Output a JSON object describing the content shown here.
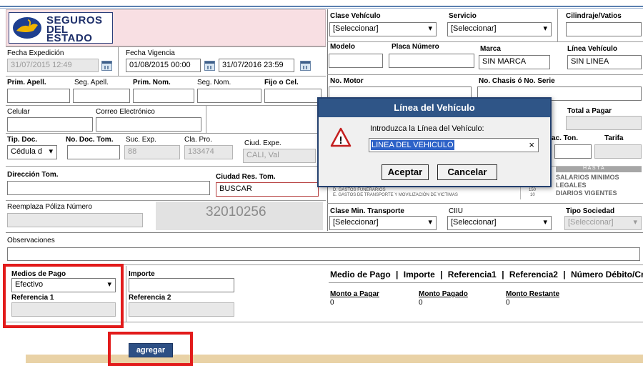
{
  "logo": {
    "line1": "SEGUROS",
    "line2": "DEL",
    "line3": "ESTADO"
  },
  "dates": {
    "fecha_expedicion_label": "Fecha Expedición",
    "fecha_expedicion": "31/07/2015 12:49",
    "fecha_vigencia_label": "Fecha Vigencia",
    "vigencia_desde": "01/08/2015 00:00",
    "vigencia_hasta": "31/07/2016 23:59"
  },
  "vehicle": {
    "clase_label": "Clase Vehículo",
    "clase_value": "[Seleccionar]",
    "servicio_label": "Servicio",
    "servicio_value": "[Seleccionar]",
    "cilindraje_label": "Cilindraje/Vatios",
    "modelo_label": "Modelo",
    "placa_label": "Placa Número",
    "marca_label": "Marca",
    "marca_value": "SIN MARCA",
    "linea_label": "Línea Vehículo",
    "linea_value": "SIN LINEA",
    "motor_label": "No. Motor",
    "chasis_label": "No. Chasis ó No. Serie",
    "total_label": "Total a Pagar",
    "cap_ton_label": "ac. Ton.",
    "tarifa_label": "Tarifa",
    "hasta_title": "H A S T A",
    "hasta_1": "SALARIOS MINIMOS",
    "hasta_2": "LEGALES",
    "hasta_3": "DIARIOS VIGENTES",
    "gastos_1": "D. GASTOS FUNERARIOS",
    "gastos_2": "E. GASTOS DE TRANSPORTE Y MOVILIZACIÓN DE VICTIMAS",
    "gastos_v1": "150",
    "gastos_v2": "10"
  },
  "tomador": {
    "prim_apell_label": "Prim. Apell.",
    "seg_apell_label": "Seg. Apell.",
    "prim_nom_label": "Prim. Nom.",
    "seg_nom_label": "Seg. Nom.",
    "fijo_label": "Fijo o Cel.",
    "celular_label": "Celular",
    "correo_label": "Correo Electrónico",
    "tip_doc_label": "Tip. Doc.",
    "tip_doc_value": "Cédula d",
    "no_doc_label": "No. Doc. Tom.",
    "suc_exp_label": "Suc. Exp.",
    "suc_exp_value": "88",
    "cla_pro_label": "Cla. Pro.",
    "cla_pro_value": "133474",
    "ciud_expe_label": "Ciud. Expe.",
    "ciud_expe_value": "CALI, Val",
    "direccion_label": "Dirección Tom.",
    "ciudad_res_label": "Ciudad Res. Tom.",
    "ciudad_res_value": "BUSCAR",
    "reemplaza_label": "Reemplaza Póliza Número",
    "poliza_number": "32010256"
  },
  "bottom": {
    "clase_min_label": "Clase Min. Transporte",
    "clase_min_value": "[Seleccionar]",
    "ciiu_label": "CIIU",
    "ciiu_value": "[Seleccionar]",
    "tipo_soc_label": "Tipo Sociedad",
    "tipo_soc_value": "[Seleccionar]",
    "observaciones_label": "Observaciones"
  },
  "payment": {
    "medios_label": "Medios de Pago",
    "medios_value": "Efectivo",
    "importe_label": "Importe",
    "ref1_label": "Referencia 1",
    "ref2_label": "Referencia 2",
    "agregar_label": "agregar",
    "table_headers": [
      "Medio de Pago",
      "Importe",
      "Referencia1",
      "Referencia2",
      "Número Débito/Crédito"
    ],
    "monto_pagar_label": "Monto a Pagar",
    "monto_pagar_value": "0",
    "monto_pagado_label": "Monto Pagado",
    "monto_pagado_value": "0",
    "monto_restante_label": "Monto Restante",
    "monto_restante_value": "0"
  },
  "dialog": {
    "title": "Línea del Vehículo",
    "prompt": "Introduzca la Línea del Vehículo:",
    "input_value": "LINEA DEL VEHICULO",
    "clear_glyph": "×",
    "accept_label": "Aceptar",
    "cancel_label": "Cancelar",
    "warning_glyph": "!"
  }
}
